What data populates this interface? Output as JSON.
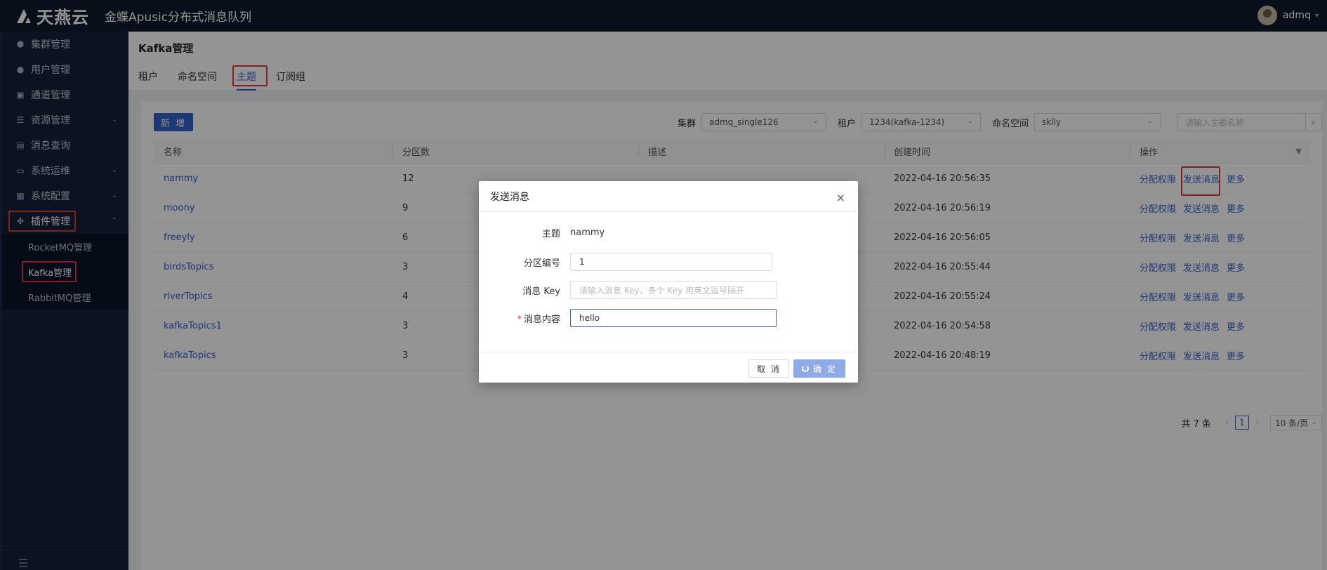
{
  "app": {
    "brand": "天燕云",
    "title": "金蝶Apusic分布式消息队列"
  },
  "user": {
    "name": "admq"
  },
  "sidebar": {
    "items": [
      {
        "label": "集群管理",
        "icon": "cube-icon"
      },
      {
        "label": "用户管理",
        "icon": "user-icon"
      },
      {
        "label": "通道管理",
        "icon": "channel-icon"
      },
      {
        "label": "资源管理",
        "icon": "server-icon"
      },
      {
        "label": "消息查询",
        "icon": "search-doc-icon"
      },
      {
        "label": "系统运维",
        "icon": "monitor-icon"
      },
      {
        "label": "系统配置",
        "icon": "config-icon"
      },
      {
        "label": "插件管理",
        "icon": "plugin-icon"
      }
    ],
    "sub_items": [
      "RocketMQ管理",
      "Kafka管理",
      "RabbitMQ管理"
    ]
  },
  "page": {
    "title": "Kafka管理",
    "tabs": [
      "租户",
      "命名空间",
      "主题",
      "订阅组"
    ]
  },
  "toolbar": {
    "add_label": "新 增",
    "cluster_label": "集群",
    "cluster_value": "admq_single126",
    "tenant_label": "租户",
    "tenant_value": "1234(kafka-1234)",
    "namespace_label": "命名空间",
    "namespace_value": "sklly",
    "search_placeholder": "请输入主题名称"
  },
  "table": {
    "headers": [
      "名称",
      "分区数",
      "描述",
      "创建时间",
      "操作"
    ],
    "rows": [
      {
        "name": "nammy",
        "partitions": "12",
        "desc": "",
        "created": "2022-04-16 20:56:35"
      },
      {
        "name": "moony",
        "partitions": "9",
        "desc": "",
        "created": "2022-04-16 20:56:19"
      },
      {
        "name": "freeyly",
        "partitions": "6",
        "desc": "",
        "created": "2022-04-16 20:56:05"
      },
      {
        "name": "birdsTopics",
        "partitions": "3",
        "desc": "",
        "created": "2022-04-16 20:55:44"
      },
      {
        "name": "riverTopics",
        "partitions": "4",
        "desc": "",
        "created": "2022-04-16 20:55:24"
      },
      {
        "name": "kafkaTopics1",
        "partitions": "3",
        "desc": "",
        "created": "2022-04-16 20:54:58"
      },
      {
        "name": "kafkaTopics",
        "partitions": "3",
        "desc": "",
        "created": "2022-04-16 20:48:19"
      }
    ],
    "ops": {
      "assign": "分配权限",
      "send": "发送消息",
      "more": "更多"
    }
  },
  "pager": {
    "total": "共 7 条",
    "page": "1",
    "size": "10 条/页"
  },
  "modal": {
    "title": "发送消息",
    "topic_label": "主题",
    "topic_value": "nammy",
    "partition_label": "分区编号",
    "partition_value": "1",
    "key_label": "消息 Key",
    "key_placeholder": "请输入消息 Key，多个 Key 用英文逗号隔开",
    "content_label": "消息内容",
    "content_value": "hello",
    "cancel": "取 消",
    "ok": "确 定"
  },
  "colors": {
    "accent": "#3561c7",
    "highlight": "#e03a3a",
    "topbar": "#0e1a2e",
    "sidebar": "#14213a"
  }
}
